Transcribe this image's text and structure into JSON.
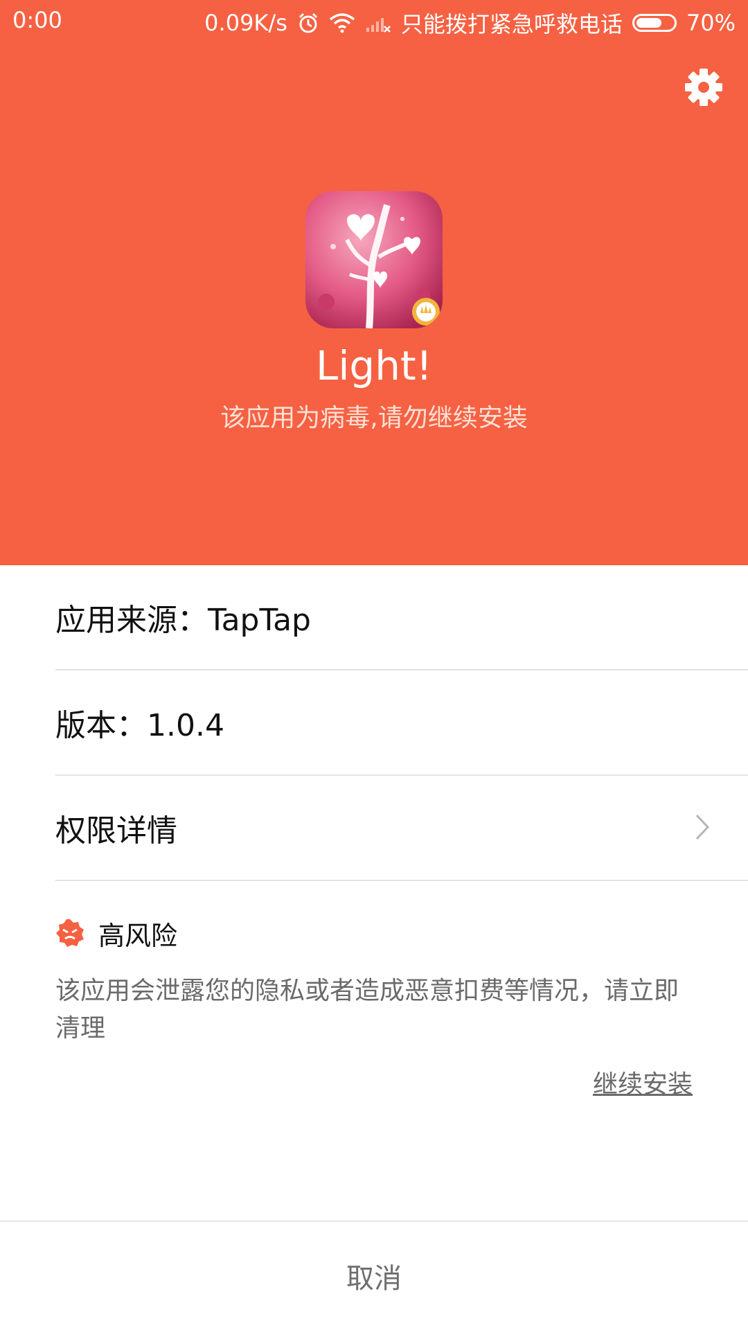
{
  "status_bar": {
    "time": "0:00",
    "net_speed": "0.09K/s",
    "carrier": "只能拨打紧急呼救电话",
    "battery_text": "70%",
    "battery_level": 0.7,
    "icons": [
      "alarm-icon",
      "wifi-icon",
      "signal-none-icon",
      "battery-icon"
    ]
  },
  "header": {
    "bg_color": "#f56142",
    "settings_icon": "gear-icon",
    "app_name": "Light!",
    "warning": "该应用为病毒,请勿继续安装"
  },
  "details": {
    "source": "应用来源：TapTap",
    "version": "版本：1.0.4",
    "permissions": "权限详情"
  },
  "risk": {
    "title": "高风险",
    "icon": "risk-badge-icon",
    "description": "该应用会泄露您的隐私或者造成恶意扣费等情况，请立即清理",
    "continue_label": "继续安装"
  },
  "footer": {
    "cancel_label": "取消"
  }
}
